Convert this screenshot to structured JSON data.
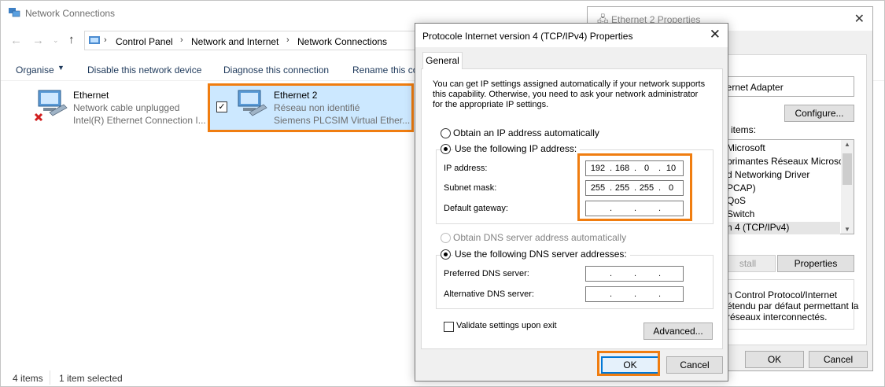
{
  "explorer": {
    "title": "Network Connections",
    "breadcrumbs": [
      "Control Panel",
      "Network and Internet",
      "Network Connections"
    ],
    "toolbar": {
      "organise": "Organise",
      "disable": "Disable this network device",
      "diagnose": "Diagnose this connection",
      "rename": "Rename this co"
    },
    "items": [
      {
        "name": "Ethernet",
        "status": "Network cable unplugged",
        "adapter": "Intel(R) Ethernet Connection I...",
        "selected": false
      },
      {
        "name": "Ethernet 2",
        "status": "Réseau non identifié",
        "adapter": "Siemens PLCSIM Virtual Ether...",
        "selected": true
      }
    ],
    "status_count": "4 items",
    "status_selected": "1 item selected"
  },
  "props": {
    "title": "Ethernet 2 Properties",
    "adapter_text": "hernet Adapter",
    "configure": "Configure...",
    "items_label": "g items:",
    "list": [
      "Microsoft",
      "primantes Réseaux Microsoft",
      "d Networking Driver",
      "PCAP)",
      "QoS",
      "Switch",
      "n 4 (TCP/IPv4)"
    ],
    "install": "stall",
    "properties": "Properties",
    "description": [
      "n Control Protocol/Internet",
      "étendu par défaut permettant la",
      "réseaux interconnectés."
    ],
    "ok": "OK",
    "cancel": "Cancel"
  },
  "dialog": {
    "title": "Protocole Internet version 4 (TCP/IPv4) Properties",
    "tab": "General",
    "intro": [
      "You can get IP settings assigned automatically if your network supports",
      "this capability. Otherwise, you need to ask your network administrator",
      "for the appropriate IP settings."
    ],
    "obtain_ip": "Obtain an IP address automatically",
    "use_ip": "Use the following IP address:",
    "ip_label": "IP address:",
    "ip": [
      "192",
      "168",
      "0",
      "10"
    ],
    "mask_label": "Subnet mask:",
    "mask": [
      "255",
      "255",
      "255",
      "0"
    ],
    "gateway_label": "Default gateway:",
    "obtain_dns": "Obtain DNS server address automatically",
    "use_dns": "Use the following DNS server addresses:",
    "pref_dns": "Preferred DNS server:",
    "alt_dns": "Alternative DNS server:",
    "validate": "Validate settings upon exit",
    "advanced": "Advanced...",
    "ok": "OK",
    "cancel": "Cancel"
  },
  "colors": {
    "highlight": "#f07d10",
    "selection": "#cce8ff",
    "accent": "#0078d7"
  }
}
